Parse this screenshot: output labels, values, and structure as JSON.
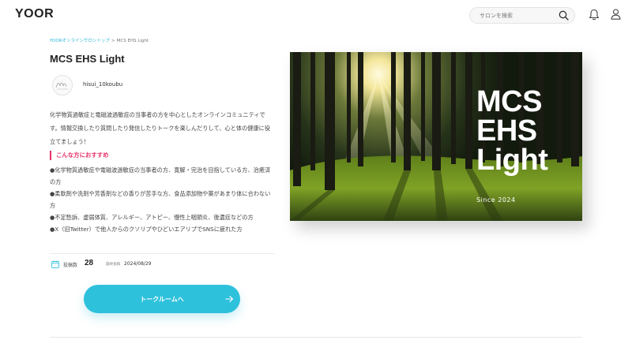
{
  "header": {
    "logo": "YOOR",
    "search_placeholder": "サロンを検索",
    "icons": [
      "search-icon",
      "bell-icon",
      "user-icon"
    ]
  },
  "breadcrumb": {
    "home": "YOORオンラインサロントップ",
    "separator": ">",
    "current": "MCS EHS Light"
  },
  "salon": {
    "title": "MCS EHS Light",
    "owner": "hisui_10koubu",
    "description": "化学物質過敏症と電磁波過敏症の当事者の方を中心としたオンラインコミュニティです。情報交換したり質問したり発信したりトークを楽しんだりして、心と体の健康に役立てましょう！",
    "recommend_heading": "こんな方におすすめ",
    "recommend_items": [
      "●化学物質過敏症や電磁波過敏症の当事者の方、寛解・完治を目指している方、治癒済の方",
      "●柔軟剤や洗剤や芳香剤などの香りが苦手な方、食品添加物や薬があまり体に合わない方",
      "●不定愁訴、虚弱体質、アレルギー、アトピー、慢性上咽頭炎、後遺症などの方",
      "●X（旧Twitter）で他人からのクソリプやひどいエアリプでSNSに疲れた方"
    ],
    "stats": {
      "posts_label": "投稿数",
      "posts_count": "28",
      "latest_label": "最終投稿",
      "latest_date": "2024/08/29"
    },
    "cta_label": "トークルームへ",
    "cover": {
      "logo_lines": [
        "MCS",
        "EHS",
        "Light"
      ],
      "since": "Since 2024"
    }
  },
  "colors": {
    "accent": "#2ec1dc",
    "link": "#2bb6d6",
    "highlight": "#e8336b"
  }
}
